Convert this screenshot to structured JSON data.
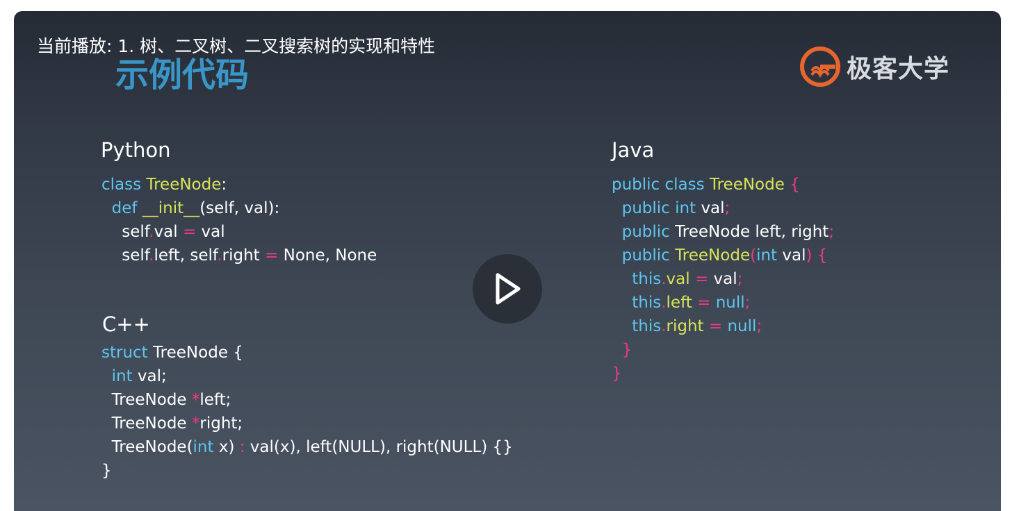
{
  "now_playing": "当前播放: 1. 树、二叉树、二叉搜索树的实现和特性",
  "slide_title": "示例代码",
  "brand": {
    "name": "极客大学",
    "icon": "geekbang-logo-icon",
    "color": "#e8652c"
  },
  "play_icon": "play-icon",
  "colors": {
    "keyword": "#5ec5ef",
    "type": "#d8e35a",
    "operator": "#ee3a86",
    "plain": "#ffffff",
    "title": "#3a96c8"
  },
  "sections": {
    "python": {
      "heading": "Python",
      "lines": [
        {
          "indent": "",
          "tokens": [
            [
              "kw",
              "class "
            ],
            [
              "tp",
              "TreeNode"
            ],
            [
              "pl",
              ":"
            ]
          ]
        },
        {
          "indent": "  ",
          "tokens": [
            [
              "kw",
              "def "
            ],
            [
              "tp",
              "__init__"
            ],
            [
              "pl",
              "(self, val):"
            ]
          ]
        },
        {
          "indent": "    ",
          "tokens": [
            [
              "pl",
              "self"
            ],
            [
              "op",
              "."
            ],
            [
              "pl",
              "val "
            ],
            [
              "op",
              "="
            ],
            [
              "pl",
              " val"
            ]
          ]
        },
        {
          "indent": "    ",
          "tokens": [
            [
              "pl",
              "self"
            ],
            [
              "op",
              "."
            ],
            [
              "pl",
              "left, self"
            ],
            [
              "op",
              "."
            ],
            [
              "pl",
              "right "
            ],
            [
              "op",
              "="
            ],
            [
              "pl",
              " None, None"
            ]
          ]
        }
      ]
    },
    "cpp": {
      "heading": "C++",
      "lines": [
        {
          "indent": "",
          "tokens": [
            [
              "kw",
              "struct "
            ],
            [
              "pl",
              "TreeNode {"
            ]
          ]
        },
        {
          "indent": "  ",
          "tokens": [
            [
              "kw",
              "int "
            ],
            [
              "pl",
              "val;"
            ]
          ]
        },
        {
          "indent": "  ",
          "tokens": [
            [
              "pl",
              "TreeNode "
            ],
            [
              "op",
              "*"
            ],
            [
              "pl",
              "left;"
            ]
          ]
        },
        {
          "indent": "  ",
          "tokens": [
            [
              "pl",
              "TreeNode "
            ],
            [
              "op",
              "*"
            ],
            [
              "pl",
              "right;"
            ]
          ]
        },
        {
          "indent": "  ",
          "tokens": [
            [
              "pl",
              "TreeNode("
            ],
            [
              "kw",
              "int "
            ],
            [
              "pl",
              "x) "
            ],
            [
              "op",
              ":"
            ],
            [
              "pl",
              " val(x), left(NULL), right(NULL) {}"
            ]
          ]
        },
        {
          "indent": "",
          "tokens": [
            [
              "pl",
              "}"
            ]
          ]
        }
      ]
    },
    "java": {
      "heading": "Java",
      "lines": [
        {
          "indent": "",
          "tokens": [
            [
              "kw",
              "public class "
            ],
            [
              "tp",
              "TreeNode "
            ],
            [
              "op",
              "{"
            ]
          ]
        },
        {
          "indent": "  ",
          "tokens": [
            [
              "kw",
              "public int "
            ],
            [
              "pl",
              "val"
            ],
            [
              "op",
              ";"
            ]
          ]
        },
        {
          "indent": "  ",
          "tokens": [
            [
              "kw",
              "public "
            ],
            [
              "pl",
              "TreeNode left, right"
            ],
            [
              "op",
              ";"
            ]
          ]
        },
        {
          "indent": "  ",
          "tokens": [
            [
              "kw",
              "public "
            ],
            [
              "tp",
              "TreeNode"
            ],
            [
              "op",
              "("
            ],
            [
              "kw",
              "int "
            ],
            [
              "pl",
              "val"
            ],
            [
              "op",
              ") {"
            ]
          ]
        },
        {
          "indent": "    ",
          "tokens": [
            [
              "kw",
              "this"
            ],
            [
              "op",
              "."
            ],
            [
              "tp",
              "val "
            ],
            [
              "op",
              "= "
            ],
            [
              "pl",
              "val"
            ],
            [
              "op",
              ";"
            ]
          ]
        },
        {
          "indent": "    ",
          "tokens": [
            [
              "kw",
              "this"
            ],
            [
              "op",
              "."
            ],
            [
              "tp",
              "left "
            ],
            [
              "op",
              "= "
            ],
            [
              "kw",
              "null"
            ],
            [
              "op",
              ";"
            ]
          ]
        },
        {
          "indent": "    ",
          "tokens": [
            [
              "kw",
              "this"
            ],
            [
              "op",
              "."
            ],
            [
              "tp",
              "right "
            ],
            [
              "op",
              "= "
            ],
            [
              "kw",
              "null"
            ],
            [
              "op",
              ";"
            ]
          ]
        },
        {
          "indent": "  ",
          "tokens": [
            [
              "op",
              "}"
            ]
          ]
        },
        {
          "indent": "",
          "tokens": [
            [
              "op",
              "}"
            ]
          ]
        }
      ]
    }
  }
}
